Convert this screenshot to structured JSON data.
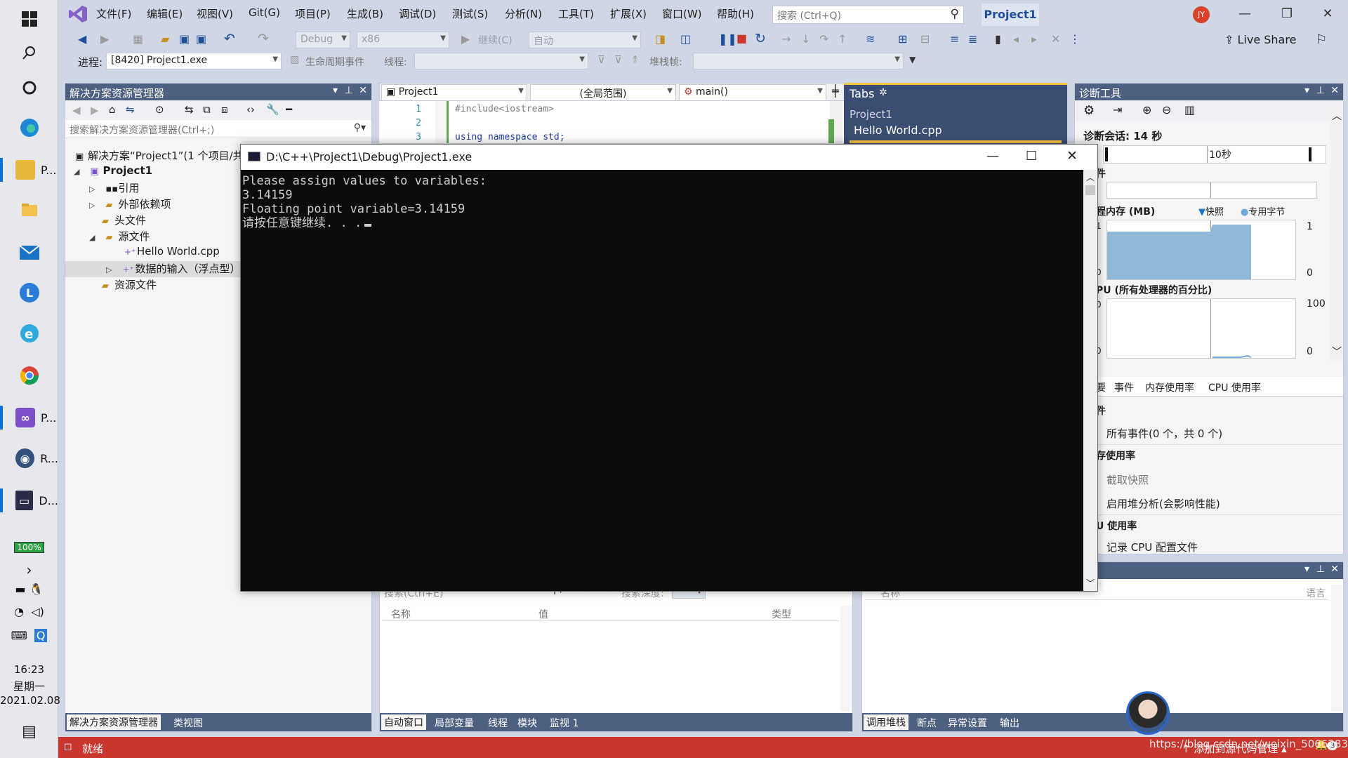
{
  "taskbar": {
    "apps": [
      {
        "label": "P...",
        "icon": "folder-icon"
      },
      {
        "label": "P...",
        "icon": "visual-studio-icon"
      },
      {
        "label": "R...",
        "icon": "app-r-icon"
      },
      {
        "label": "D...",
        "icon": "console-icon"
      }
    ],
    "battery": "100%",
    "time": "16:23",
    "weekday": "星期一",
    "date": "2021.02.08"
  },
  "vs": {
    "menu": [
      "文件(F)",
      "编辑(E)",
      "视图(V)",
      "Git(G)",
      "项目(P)",
      "生成(B)",
      "调试(D)",
      "测试(S)",
      "分析(N)",
      "工具(T)",
      "扩展(X)",
      "窗口(W)",
      "帮助(H)"
    ],
    "search_placeholder": "搜索 (Ctrl+Q)",
    "project_name": "Project1",
    "user_initials": "JY",
    "live_share": "Live Share",
    "toolbar": {
      "config": "Debug",
      "platform": "x86",
      "continue": "继续(C)",
      "auto": "自动"
    },
    "toolbar2": {
      "process_label": "进程:",
      "process_value": "[8420] Project1.exe",
      "lifecycle": "生命周期事件",
      "thread_label": "线程:",
      "stack_label": "堆栈帧:"
    }
  },
  "solution_explorer": {
    "title": "解决方案资源管理器",
    "search_placeholder": "搜索解决方案资源管理器(Ctrl+;)",
    "tree": [
      {
        "label": "解决方案“Project1”(1 个项目/共",
        "indent": 0
      },
      {
        "label": "Project1",
        "indent": 1
      },
      {
        "label": "引用",
        "indent": 2
      },
      {
        "label": "外部依赖项",
        "indent": 2
      },
      {
        "label": "头文件",
        "indent": 2
      },
      {
        "label": "源文件",
        "indent": 2
      },
      {
        "label": "Hello World.cpp",
        "indent": 3
      },
      {
        "label": "数据的输入（浮点型）",
        "indent": 3
      },
      {
        "label": "资源文件",
        "indent": 2
      }
    ],
    "bottom_tabs": [
      "解决方案资源管理器",
      "类视图"
    ]
  },
  "editor": {
    "project_combo": "Project1",
    "scope_combo": "(全局范围)",
    "function_combo": "main()",
    "lines": [
      {
        "num": "1",
        "code": "#include<iostream>"
      },
      {
        "num": "2",
        "code": ""
      },
      {
        "num": "3",
        "code": "using namespace std;"
      }
    ]
  },
  "tabs_panel": {
    "title": "Tabs",
    "group": "Project1",
    "file": "Hello World.cpp"
  },
  "diagnostics": {
    "title": "诊断工具",
    "session": "诊断会话: 14 秒",
    "timeline_label": "10秒",
    "events_label": "件",
    "memory_label": "程内存 (MB)",
    "snapshot": "快照",
    "private_bytes": "专用字节",
    "mem_max": "1",
    "mem_min": "0",
    "cpu_label": "PU (所有处理器的百分比)",
    "cpu_max": "100",
    "cpu_min": "0",
    "axis_left_top": "1",
    "axis_left_bottom": "0",
    "cpu_left_top": "0",
    "cpu_left_bottom": "0",
    "tabs": [
      "要",
      "事件",
      "内存使用率",
      "CPU 使用率"
    ],
    "section_events": "件",
    "all_events": "所有事件(0 个，共 0 个)",
    "section_memory": "存使用率",
    "take_snapshot": "截取快照",
    "heap_analysis": "启用堆分析(会影响性能)",
    "section_cpu": "U 使用率",
    "record_cpu": "记录 CPU 配置文件"
  },
  "auto_window": {
    "search_placeholder": "搜索(Ctrl+E)",
    "search_depth": "搜索深度:",
    "columns": [
      "名称",
      "值",
      "类型"
    ],
    "tabs": [
      "自动窗口",
      "局部变量",
      "线程",
      "模块",
      "监视 1"
    ]
  },
  "callstack": {
    "columns": [
      "名称",
      "语言"
    ],
    "tabs": [
      "调用堆栈",
      "断点",
      "异常设置",
      "输出"
    ]
  },
  "status": {
    "text": "就绪",
    "source_control": "添加到源代码管理",
    "badge": "3"
  },
  "console": {
    "title": "D:\\C++\\Project1\\Debug\\Project1.exe",
    "lines": [
      "Please assign values to variables:",
      "3.14159",
      "Floating point variable=3.14159",
      "请按任意键继续. . ."
    ]
  },
  "watermark": "https://blog.csdn.net/weixin_50662834",
  "colors": {
    "status_bar": "#c8362d",
    "panel_header": "#4d6082",
    "console_bg": "#0c0c0c",
    "accent": "#1f4e9a"
  }
}
